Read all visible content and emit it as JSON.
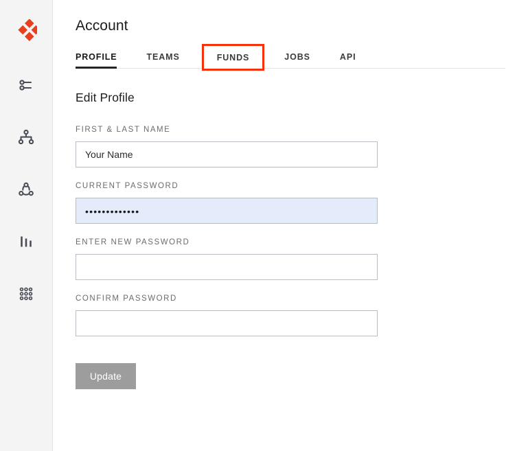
{
  "colors": {
    "brand_orange": "#e8401f",
    "highlight_box": "#f5320c",
    "sidebar_bg": "#f4f4f5",
    "autofill_blue": "#e4ebfb",
    "button_gray": "#9d9d9d",
    "icon_gray": "#4b4d56"
  },
  "sidebar": {
    "logo": {
      "name": "brand-diamond-logo"
    },
    "items": [
      {
        "icon": "sliders-icon"
      },
      {
        "icon": "hierarchy-icon"
      },
      {
        "icon": "network-share-icon"
      },
      {
        "icon": "bar-chart-icon"
      },
      {
        "icon": "dot-grid-icon"
      }
    ]
  },
  "header": {
    "title": "Account"
  },
  "tabs": [
    {
      "label": "PROFILE",
      "active": true,
      "highlighted": false
    },
    {
      "label": "TEAMS",
      "active": false,
      "highlighted": false
    },
    {
      "label": "FUNDS",
      "active": false,
      "highlighted": true
    },
    {
      "label": "JOBS",
      "active": false,
      "highlighted": false
    },
    {
      "label": "API",
      "active": false,
      "highlighted": false
    }
  ],
  "form": {
    "section_title": "Edit Profile",
    "fields": [
      {
        "label": "FIRST & LAST NAME",
        "value": "Your Name",
        "placeholder": "Your Name",
        "type": "text",
        "autofilled": false
      },
      {
        "label": "CURRENT PASSWORD",
        "value": "•••••••••••••",
        "placeholder": "",
        "type": "password",
        "autofilled": true
      },
      {
        "label": "ENTER NEW PASSWORD",
        "value": "",
        "placeholder": "",
        "type": "password",
        "autofilled": false
      },
      {
        "label": "CONFIRM PASSWORD",
        "value": "",
        "placeholder": "",
        "type": "password",
        "autofilled": false
      }
    ],
    "submit_label": "Update"
  }
}
